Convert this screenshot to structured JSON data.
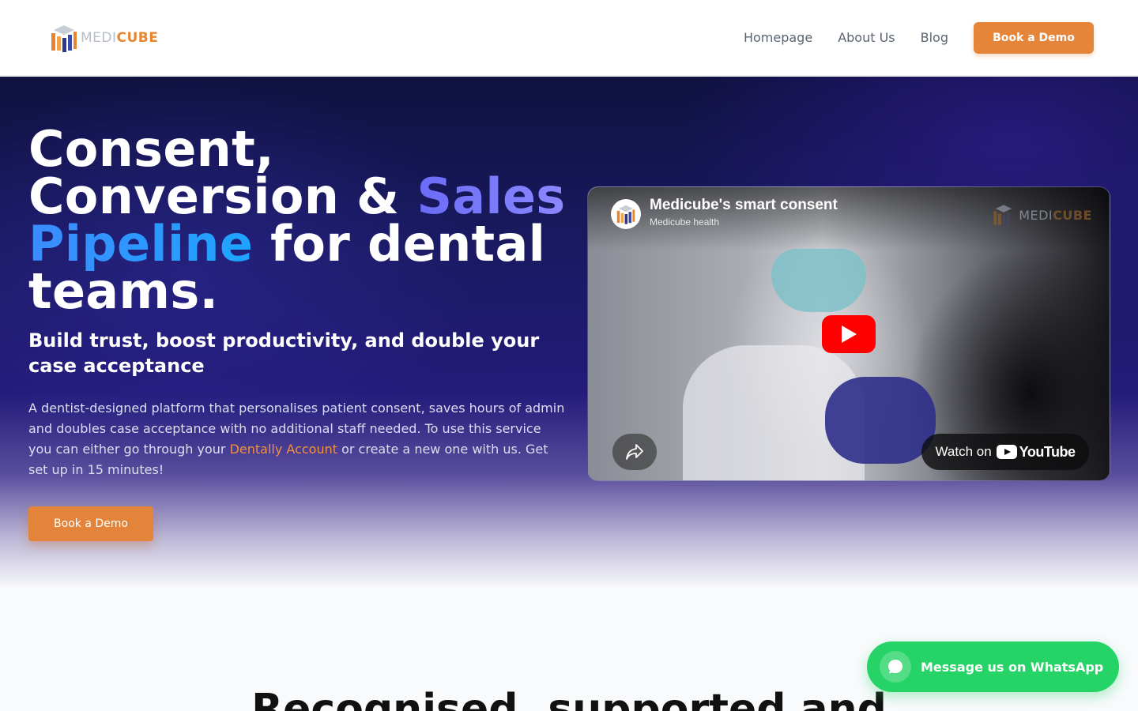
{
  "header": {
    "logo": {
      "text_light": "MEDI",
      "text_bold": "CUBE"
    },
    "nav": [
      {
        "label": "Homepage"
      },
      {
        "label": "About Us"
      },
      {
        "label": "Blog"
      }
    ],
    "cta_label": "Book a Demo"
  },
  "hero": {
    "title": {
      "line1": "Consent,",
      "line2_a": "Conversion & ",
      "line2_b": "Sales",
      "line3_a": "Pipeline",
      "line3_b": " for dental",
      "line4": "teams."
    },
    "subtitle": "Build trust, boost productivity, and double your case acceptance",
    "description": {
      "before_link": "A dentist-designed platform that personalises patient consent, saves hours of admin and doubles case acceptance with no additional staff needed. To use this service you can either go through your ",
      "link": "Dentally Account",
      "after_link": " or create a new one with us. Get set up in 15 minutes!"
    },
    "cta_label": "Book a Demo"
  },
  "video": {
    "title": "Medicube's smart consent",
    "channel": "Medicube health",
    "watch_on": "Watch on",
    "youtube": "YouTube",
    "brand_light": "MEDI",
    "brand_bold": "CUBE"
  },
  "section": {
    "heading": "Recognised, supported and"
  },
  "whatsapp": {
    "label": "Message us on WhatsApp"
  },
  "colors": {
    "accent": "#e5853a",
    "whatsapp": "#25d366",
    "youtube_red": "#ff0000",
    "hero_dark": "#1a1a63"
  },
  "icons": [
    "medicube-logo-icon",
    "play-icon",
    "share-icon",
    "youtube-icon",
    "whatsapp-chat-icon"
  ]
}
